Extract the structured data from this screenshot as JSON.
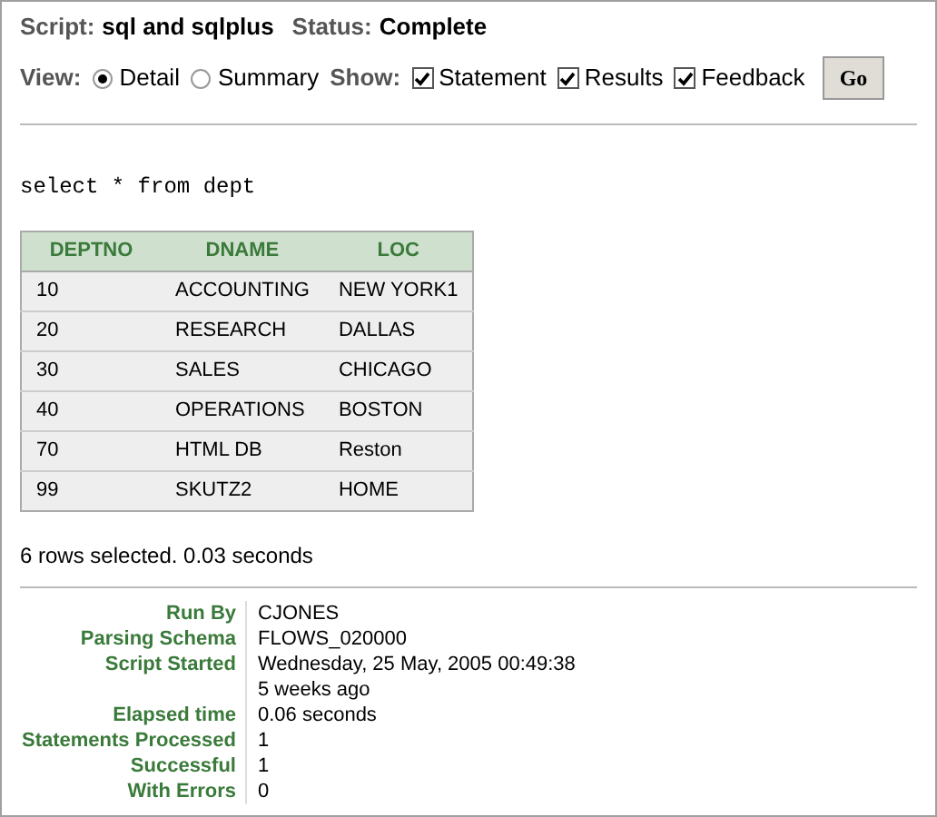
{
  "header": {
    "script_label": "Script:",
    "script_name": "sql and sqlplus",
    "status_label": "Status:",
    "status": "Complete"
  },
  "view": {
    "label": "View:",
    "options": [
      {
        "label": "Detail",
        "selected": true
      },
      {
        "label": "Summary",
        "selected": false
      }
    ]
  },
  "show": {
    "label": "Show:",
    "options": [
      {
        "label": "Statement",
        "checked": true
      },
      {
        "label": "Results",
        "checked": true
      },
      {
        "label": "Feedback",
        "checked": true
      }
    ]
  },
  "go_button": "Go",
  "statement": "select * from dept",
  "table": {
    "columns": [
      "DEPTNO",
      "DNAME",
      "LOC"
    ],
    "rows": [
      [
        "10",
        "ACCOUNTING",
        "NEW YORK1"
      ],
      [
        "20",
        "RESEARCH",
        "DALLAS"
      ],
      [
        "30",
        "SALES",
        "CHICAGO"
      ],
      [
        "40",
        "OPERATIONS",
        "BOSTON"
      ],
      [
        "70",
        "HTML DB",
        "Reston"
      ],
      [
        "99",
        "SKUTZ2",
        "HOME"
      ]
    ]
  },
  "feedback": "6 rows selected. 0.03 seconds",
  "details": [
    {
      "label": "Run By",
      "lines": [
        "CJONES"
      ]
    },
    {
      "label": "Parsing Schema",
      "lines": [
        "FLOWS_020000"
      ]
    },
    {
      "label": "Script Started",
      "lines": [
        "Wednesday, 25 May, 2005 00:49:38",
        "5 weeks ago"
      ]
    },
    {
      "label": "Elapsed time",
      "lines": [
        "0.06 seconds"
      ]
    },
    {
      "label": "Statements Processed",
      "lines": [
        "1"
      ]
    },
    {
      "label": "Successful",
      "lines": [
        "1"
      ]
    },
    {
      "label": "With Errors",
      "lines": [
        "0"
      ]
    }
  ]
}
